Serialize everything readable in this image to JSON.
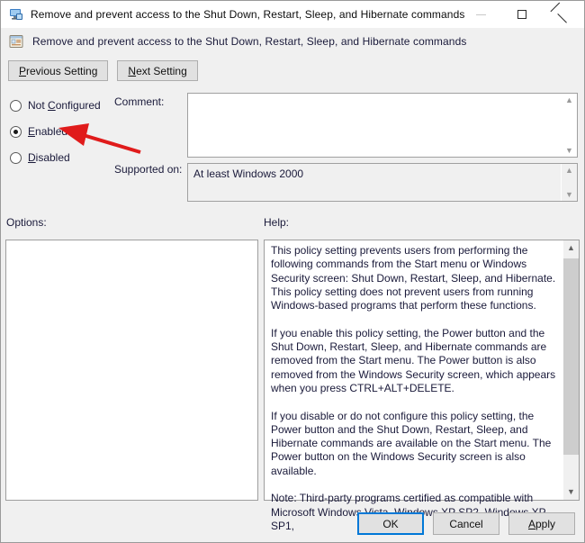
{
  "window": {
    "title": "Remove and prevent access to the Shut Down, Restart, Sleep, and Hibernate commands",
    "title_icon": "computer-policy-icon",
    "controls": {
      "minimize_label": "Minimize",
      "maximize_label": "Maximize",
      "close_label": "Close"
    }
  },
  "header": {
    "icon": "policy-setting-icon",
    "title": "Remove and prevent access to the Shut Down, Restart, Sleep, and Hibernate commands"
  },
  "nav": {
    "previous_label": "Previous Setting",
    "previous_accel": "P",
    "next_label": "Next Setting",
    "next_accel": "N"
  },
  "state": {
    "options": [
      {
        "id": "not-configured",
        "label": "Not Configured",
        "accel": "C",
        "selected": false
      },
      {
        "id": "enabled",
        "label": "Enabled",
        "accel": "E",
        "selected": true
      },
      {
        "id": "disabled",
        "label": "Disabled",
        "accel": "D",
        "selected": false
      }
    ]
  },
  "fields": {
    "comment_label": "Comment:",
    "comment_value": "",
    "supported_label": "Supported on:",
    "supported_value": "At least Windows 2000"
  },
  "panels": {
    "options_label": "Options:",
    "options_content": "",
    "help_label": "Help:",
    "help_text": "This policy setting prevents users from performing the following commands from the Start menu or Windows Security screen: Shut Down, Restart, Sleep, and Hibernate. This policy setting does not prevent users from running Windows-based programs that perform these functions.\n\nIf you enable this policy setting, the Power button and the Shut Down, Restart, Sleep, and Hibernate commands are removed from the Start menu. The Power button is also removed from the Windows Security screen, which appears when you press CTRL+ALT+DELETE.\n\nIf you disable or do not configure this policy setting, the Power button and the Shut Down, Restart, Sleep, and Hibernate commands are available on the Start menu. The Power button on the Windows Security screen is also available.\n\nNote: Third-party programs certified as compatible with Microsoft Windows Vista, Windows XP SP2, Windows XP SP1,"
  },
  "footer": {
    "ok_label": "OK",
    "cancel_label": "Cancel",
    "apply_label": "Apply",
    "apply_accel": "A"
  },
  "annotation": {
    "type": "arrow",
    "color": "#e01b1b",
    "points_to": "enabled-radio"
  },
  "colors": {
    "accent": "#0078d7",
    "window_bg": "#f0f0f0",
    "titlebar_bg": "#ffffff",
    "text": "#1a1a3a",
    "annotation": "#e01b1b"
  }
}
